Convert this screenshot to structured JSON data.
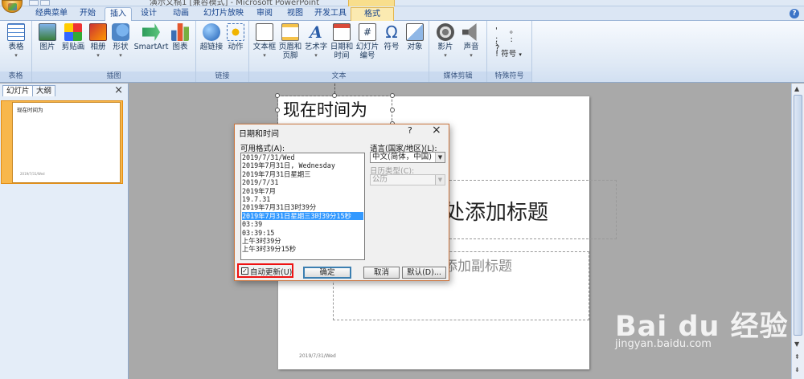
{
  "window": {
    "title": "演示文稿1 [兼容模式] - Microsoft PowerPoint"
  },
  "tabs": [
    "经典菜单",
    "开始",
    "插入",
    "设计",
    "动画",
    "幻灯片放映",
    "审阅",
    "视图",
    "开发工具",
    "格式"
  ],
  "ribbon": {
    "groups": {
      "table": "表格",
      "illustrations": "插图",
      "links": "链接",
      "text": "文本",
      "media": "媒体剪辑",
      "special": "特殊符号"
    },
    "buttons": {
      "table": "表格",
      "picture": "图片",
      "clipart": "剪贴画",
      "album": "相册",
      "shapes": "形状",
      "smartart": "SmartArt",
      "chart": "图表",
      "hyperlink": "超链接",
      "action": "动作",
      "textbox": "文本框",
      "header_footer_1": "页眉和",
      "header_footer_2": "页脚",
      "wordart": "艺术字",
      "datetime_1": "日期和",
      "datetime_2": "时间",
      "slidenum_1": "幻灯片",
      "slidenum_2": "编号",
      "symbol": "符号",
      "object": "对象",
      "movie": "影片",
      "sound": "声音",
      "special_symbol": "符号"
    },
    "symbol_rows": [
      "' 。 、",
      "; : ?",
      "!"
    ]
  },
  "left_pane": {
    "tabs": [
      "幻灯片",
      "大纲"
    ],
    "slide_number": "1",
    "thumb_title": "现在时间为"
  },
  "slide": {
    "textbox": "现在时间为",
    "title_placeholder": "处添加标题",
    "subtitle_placeholder": "添加副标题",
    "footer_date": "2019/7/31/Wed"
  },
  "dialog": {
    "title": "日期和时间",
    "help": "?",
    "close": "×",
    "formats_label": "可用格式(A):",
    "formats": [
      "2019/7/31/Wed",
      "2019年7月31日, Wednesday",
      "2019年7月31日星期三",
      "2019/7/31",
      "2019年7月",
      "19.7.31",
      "2019年7月31日3时39分",
      "2019年7月31日星期三3时39分15秒",
      "03:39",
      "03:39:15",
      "上午3时39分",
      "上午3时39分15秒"
    ],
    "selected_index": 7,
    "language_label": "语言(国家/地区)(L):",
    "language_value": "中文(简体，中国)",
    "calendar_label": "日历类型(C):",
    "calendar_value": "公历",
    "auto_update": "自动更新(U)",
    "auto_update_checked": true,
    "ok": "确定",
    "cancel": "取消",
    "default": "默认(D)..."
  },
  "watermark": {
    "brand": "Bai du 经验",
    "url": "jingyan.baidu.com"
  },
  "colors": {
    "ribbon": "#dfe9f5",
    "selection": "#3399ff",
    "highlight_box": "#e11111",
    "thumb_select": "#f8b74b"
  }
}
